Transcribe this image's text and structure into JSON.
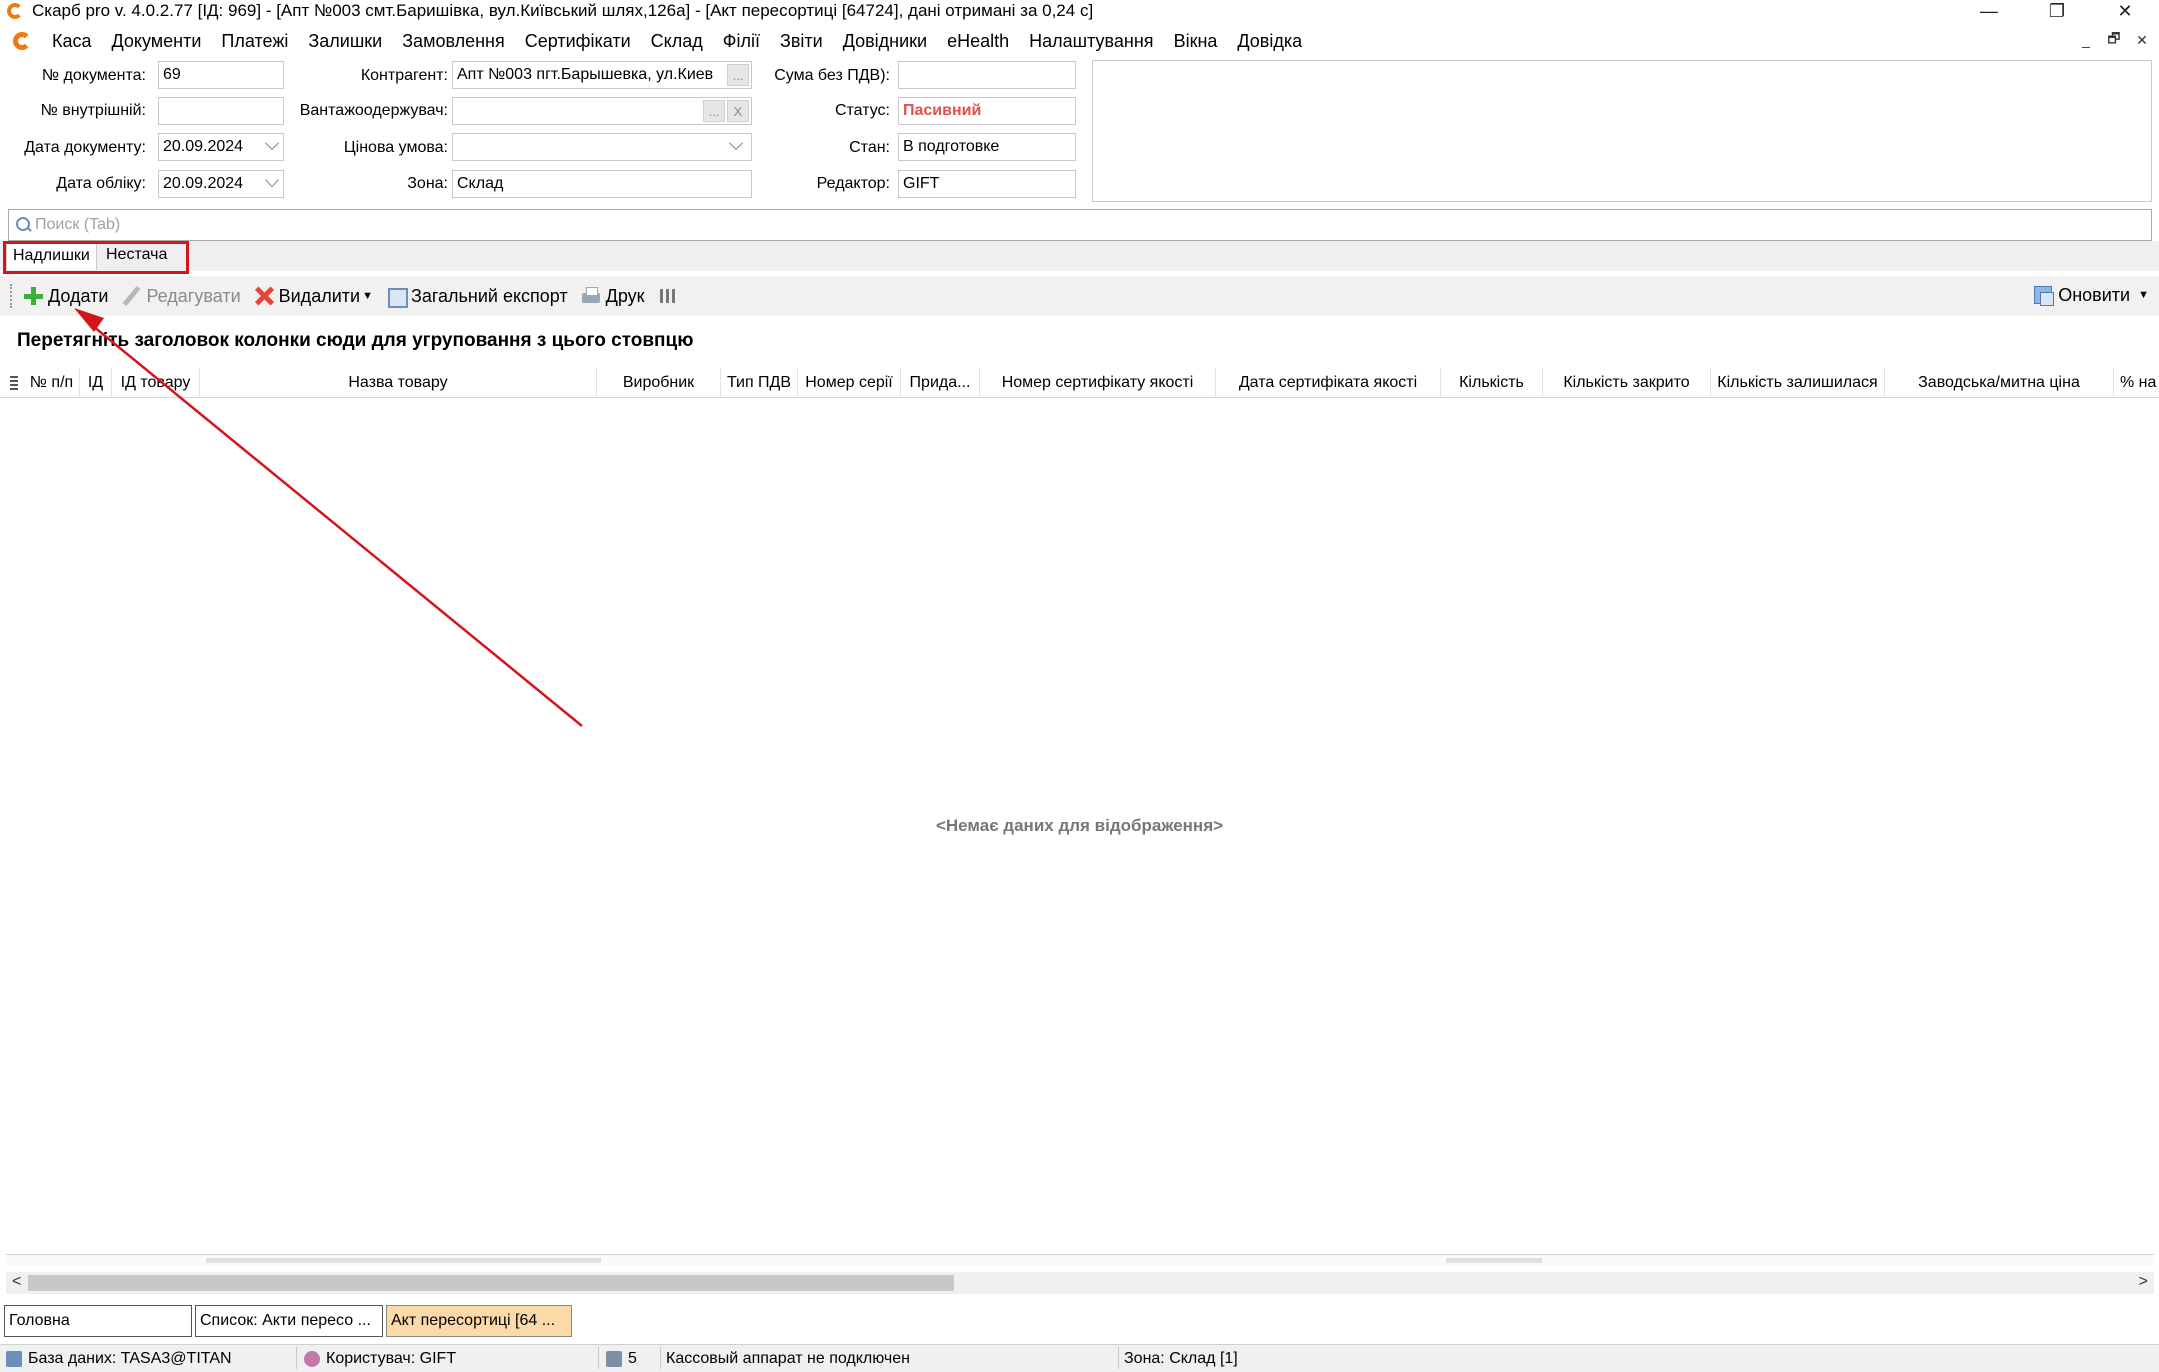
{
  "window": {
    "title": "Скарб pro v. 4.0.2.77 [ІД: 969] - [Апт №003 смт.Баришівка, вул.Київський шлях,126а] - [Акт пересортиці [64724], дані отримані за 0,24 с]",
    "minimize": "—",
    "restore": "❐",
    "close": "✕"
  },
  "menu": {
    "items": [
      "Каса",
      "Документи",
      "Платежі",
      "Залишки",
      "Замовлення",
      "Сертифікати",
      "Склад",
      "Філії",
      "Звіти",
      "Довідники",
      "eHealth",
      "Налаштування",
      "Вікна",
      "Довідка"
    ],
    "mdi_minimize": "_",
    "mdi_restore": "🗗",
    "mdi_close": "✕"
  },
  "form": {
    "doc_number_label": "№ документа:",
    "doc_number": "69",
    "internal_number_label": "№ внутрішній:",
    "internal_number": "",
    "doc_date_label": "Дата документу:",
    "doc_date": "20.09.2024",
    "account_date_label": "Дата обліку:",
    "account_date": "20.09.2024",
    "counterparty_label": "Контрагент:",
    "counterparty": "Апт №003 пгт.Барышевка, ул.Киев",
    "consignee_label": "Вантажоодержувач:",
    "consignee": "",
    "price_condition_label": "Цінова умова:",
    "price_condition": "",
    "zone_label": "Зона:",
    "zone": "Склад",
    "sum_no_vat_label": "Сума без ПДВ):",
    "sum_no_vat": "",
    "status_label": "Статус:",
    "status": "Пасивний",
    "state_label": "Стан:",
    "state": "В подготовке",
    "editor_label": "Редактор:",
    "editor": "GIFT",
    "ellipsis": "...",
    "clear": "X"
  },
  "search": {
    "placeholder": "Поиск (Tab)"
  },
  "tabs": [
    {
      "label": "Надлишки",
      "active": true
    },
    {
      "label": "Нестача",
      "active": false
    }
  ],
  "toolbar": {
    "add": "Додати",
    "edit": "Редагувати",
    "delete": "Видалити",
    "export": "Загальний експорт",
    "print": "Друк",
    "refresh": "Оновити"
  },
  "grid": {
    "group_hint": "Перетягніть заголовок колонки сюди для угруповання з цього стовпцю",
    "columns": [
      "№ п/п",
      "ІД",
      "ІД товару",
      "Назва товару",
      "Виробник",
      "Тип ПДВ",
      "Номер серії",
      "Прида...",
      "Номер сертифікату якості",
      "Дата сертифіката якості",
      "Кількість",
      "Кількість закрито",
      "Кількість залишилася",
      "Заводська/митна ціна",
      "% на"
    ],
    "empty_message": "<Немає даних для відображення>"
  },
  "window_tabs": [
    {
      "label": "Головна",
      "active": false
    },
    {
      "label": "Список: Акти пересо ...",
      "active": false
    },
    {
      "label": "Акт пересортиці [64 ...",
      "active": true
    }
  ],
  "status_bar": {
    "database": "База даних: TASA3@TITAN",
    "user": "Користувач: GIFT",
    "register_count": "5",
    "cash_register": "Кассовый аппарат не подключен",
    "zone": "Зона: Склад [1]"
  },
  "colors": {
    "annotation": "#d4151b",
    "status_passive": "#e0524a",
    "active_window_tab": "#fcd9a8",
    "logo": "#f07a12"
  }
}
